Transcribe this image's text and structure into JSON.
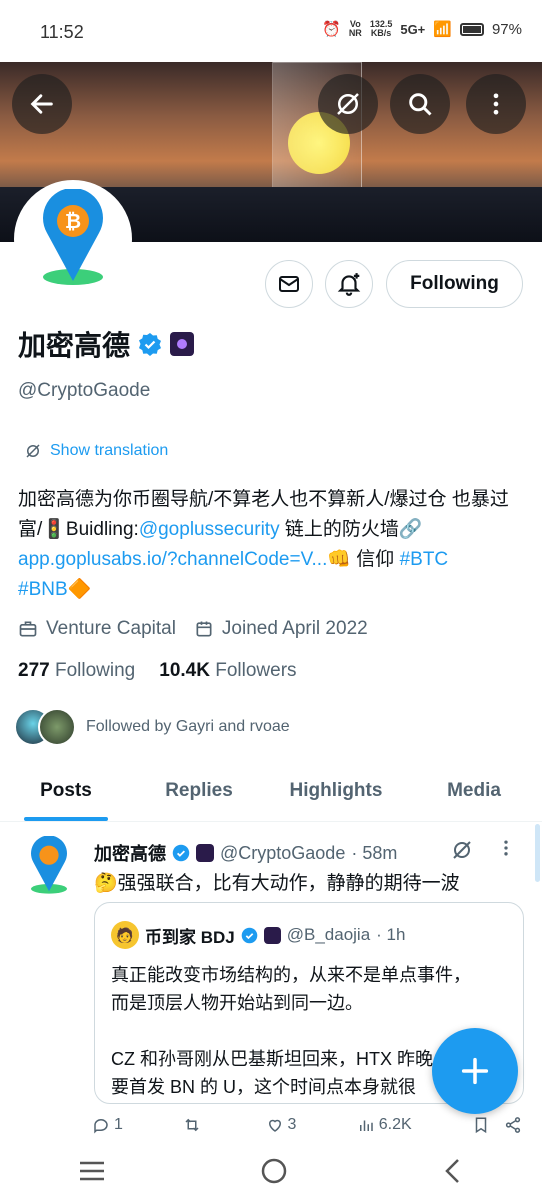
{
  "status_bar": {
    "time": "11:52",
    "net_speed": "132.5",
    "net_unit": "KB/s",
    "volte": "Vo",
    "volte2": "NR",
    "network": "5G+",
    "battery": "97%"
  },
  "profile": {
    "name": "加密高德",
    "handle": "@CryptoGaode",
    "show_translation": "Show translation",
    "bio_part1": "加密高德为你币圈导航/不算老人也不算新人/爆过仓 也暴过富/🚦Buidling:",
    "bio_link1": "@goplussecurity",
    "bio_part2": " 链上的防火墙🔗",
    "bio_link2": "app.goplusabs.io/?channelCode=V...",
    "bio_part3": "👊 信仰 ",
    "bio_tag1": "#BTC",
    "bio_tag2": "#BNB",
    "bio_emoji": "🔶",
    "category": "Venture Capital",
    "joined": "Joined April 2022",
    "following_count": "277",
    "following_label": "Following",
    "followers_count": "10.4K",
    "followers_label": "Followers",
    "followed_by": "Followed by Gayri and rvoae",
    "follow_button": "Following"
  },
  "tabs": [
    "Posts",
    "Replies",
    "Highlights",
    "Media"
  ],
  "post": {
    "author": "加密高德",
    "handle": "@CryptoGaode",
    "time": "· 58m",
    "text": "🤔强强联合，比有大动作，静静的期待一波",
    "quote": {
      "author": "币到家 BDJ",
      "handle": "@B_daojia",
      "time": "· 1h",
      "line1": "真正能改变市场结构的，从来不是单点事件，",
      "line2": "而是顶层人物开始站到同一边。",
      "line3": "CZ 和孙哥刚从巴基斯坦回来，HTX 昨晚",
      "line4": "要首发 BN 的 U，这个时间点本身就很"
    },
    "replies": "1",
    "retweets": "",
    "likes": "3",
    "views": "6.2K"
  },
  "colors": {
    "accent": "#1d9bf0",
    "text": "#0f1419",
    "muted": "#536471"
  }
}
